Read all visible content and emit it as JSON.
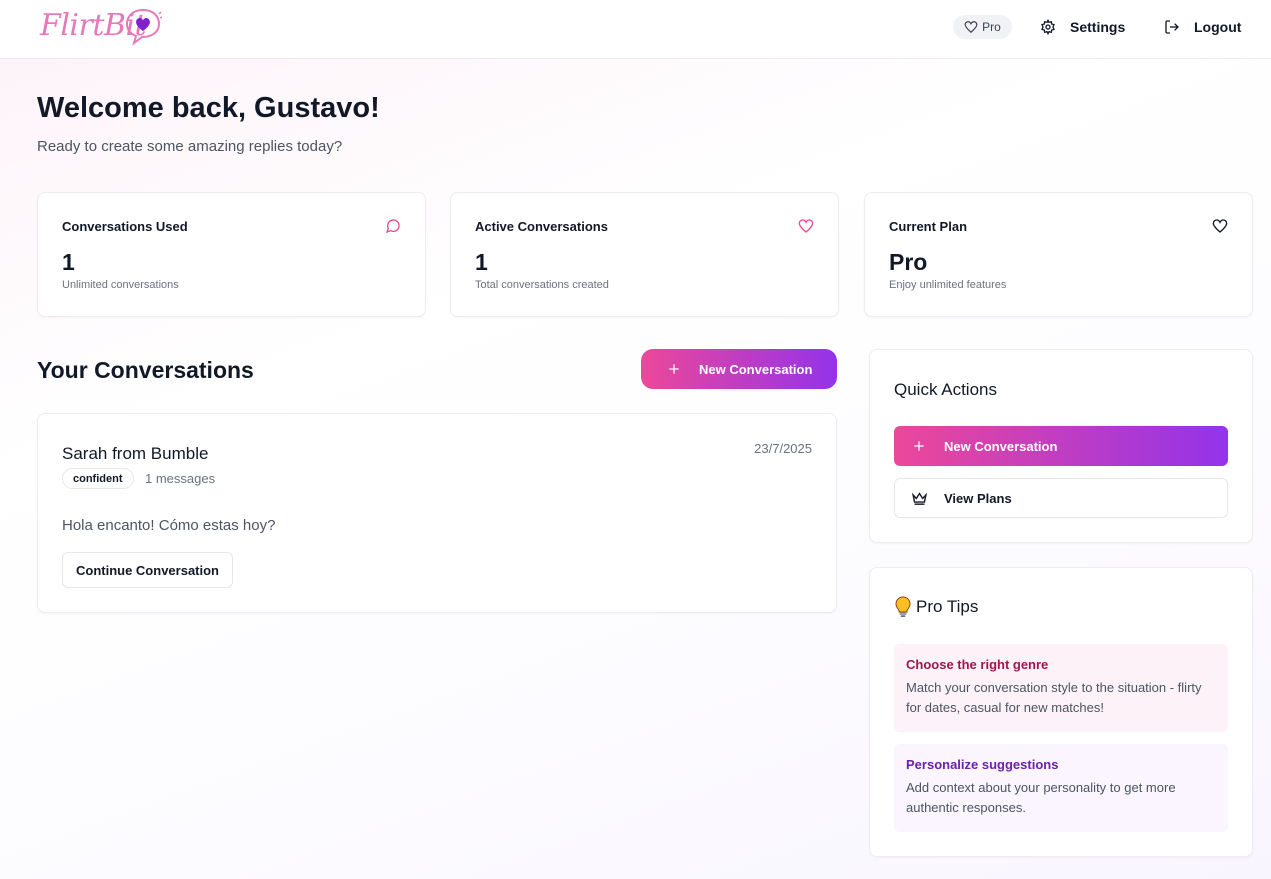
{
  "header": {
    "logo_text": "FlirtBit",
    "pro_label": "Pro",
    "settings_label": "Settings",
    "logout_label": "Logout"
  },
  "welcome": {
    "title": "Welcome back, Gustavo!",
    "subtitle": "Ready to create some amazing replies today?"
  },
  "stats": [
    {
      "label": "Conversations Used",
      "value": "1",
      "sub": "Unlimited conversations",
      "icon": "message-circle-icon"
    },
    {
      "label": "Active Conversations",
      "value": "1",
      "sub": "Total conversations created",
      "icon": "heart-icon"
    },
    {
      "label": "Current Plan",
      "value": "Pro",
      "sub": "Enjoy unlimited features",
      "icon": "heart-icon"
    }
  ],
  "conversations": {
    "title": "Your Conversations",
    "new_button": "New Conversation",
    "items": [
      {
        "name": "Sarah from Bumble",
        "date": "23/7/2025",
        "genre": "confident",
        "messages": "1 messages",
        "last_message": "Hola encanto! Cómo estas hoy?",
        "continue_label": "Continue Conversation"
      }
    ]
  },
  "quick_actions": {
    "title": "Quick Actions",
    "new_button": "New Conversation",
    "plans_button": "View Plans"
  },
  "pro_tips": {
    "title": "Pro Tips",
    "items": [
      {
        "title": "Choose the right genre",
        "text": "Match your conversation style to the situation - flirty for dates, casual for new matches!"
      },
      {
        "title": "Personalize suggestions",
        "text": "Add context about your personality to get more authentic responses."
      }
    ]
  },
  "colors": {
    "brand_pink": "#ec4899",
    "brand_purple": "#9333ea",
    "logo_pink": "#e879b9"
  }
}
